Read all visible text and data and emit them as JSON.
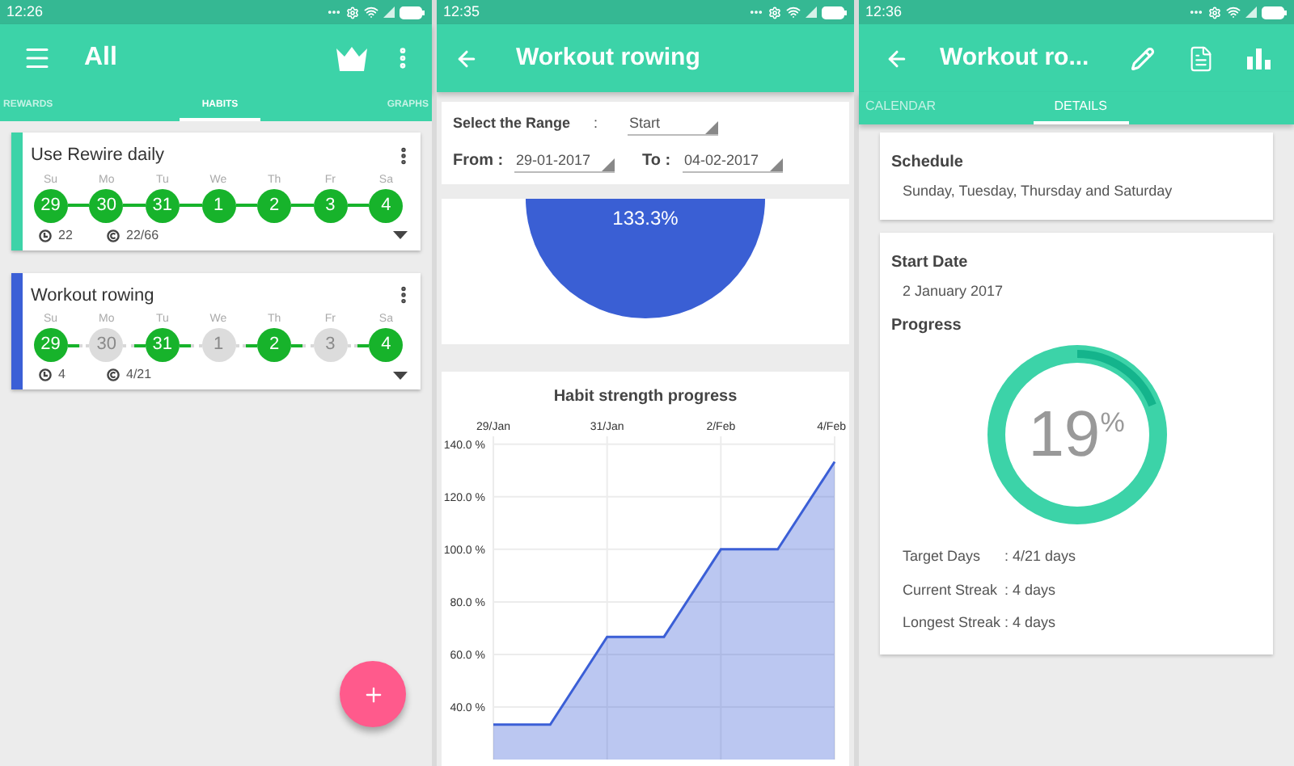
{
  "habits_screen": {
    "status_time": "12:26",
    "title": "All",
    "tabs": [
      {
        "label": "REWARDS",
        "selected": false
      },
      {
        "label": "HABITS",
        "selected": true
      },
      {
        "label": "GRAPHS",
        "selected": false
      }
    ],
    "habits": [
      {
        "name": "Use Rewire daily",
        "color": "#3dd3a8",
        "streak": "22",
        "score": "22/66",
        "days": [
          {
            "weekday": "Su",
            "date": "29",
            "done": true
          },
          {
            "weekday": "Mo",
            "date": "30",
            "done": true
          },
          {
            "weekday": "Tu",
            "date": "31",
            "done": true
          },
          {
            "weekday": "We",
            "date": "1",
            "done": true
          },
          {
            "weekday": "Th",
            "date": "2",
            "done": true
          },
          {
            "weekday": "Fr",
            "date": "3",
            "done": true
          },
          {
            "weekday": "Sa",
            "date": "4",
            "done": true
          }
        ]
      },
      {
        "name": "Workout rowing",
        "color": "#3b5fd6",
        "streak": "4",
        "score": "4/21",
        "days": [
          {
            "weekday": "Su",
            "date": "29",
            "done": true
          },
          {
            "weekday": "Mo",
            "date": "30",
            "done": false
          },
          {
            "weekday": "Tu",
            "date": "31",
            "done": true
          },
          {
            "weekday": "We",
            "date": "1",
            "done": false
          },
          {
            "weekday": "Th",
            "date": "2",
            "done": true
          },
          {
            "weekday": "Fr",
            "date": "3",
            "done": false
          },
          {
            "weekday": "Sa",
            "date": "4",
            "done": true
          }
        ]
      }
    ]
  },
  "range_screen": {
    "status_time": "12:35",
    "title": "Workout rowing",
    "range": {
      "label": "Select the Range",
      "separator": ":",
      "value": "Start"
    },
    "from": {
      "label": "From :",
      "value": "29-01-2017"
    },
    "to": {
      "label": "To :",
      "value": "04-02-2017"
    },
    "pie": {
      "label": "133.3%"
    },
    "chart_data": {
      "type": "area",
      "title": "Habit strength progress",
      "categories": [
        "29/Jan",
        null,
        "31/Jan",
        null,
        "2/Feb",
        null,
        "4/Feb"
      ],
      "ylim": [
        20,
        143
      ],
      "grid": true,
      "yticks": [
        {
          "value": 40,
          "label": "40.0 %"
        },
        {
          "value": 60,
          "label": "60.0 %"
        },
        {
          "value": 80,
          "label": "80.0 %"
        },
        {
          "value": 100,
          "label": "100.0 %"
        },
        {
          "value": 120,
          "label": "120.0 %"
        },
        {
          "value": 140,
          "label": "140.0 %"
        }
      ],
      "series": [
        {
          "color": "#3b5fd6",
          "values": [
            33.3,
            33.3,
            66.7,
            66.7,
            100,
            100,
            133.3
          ]
        }
      ]
    }
  },
  "details_screen": {
    "status_time": "12:36",
    "title": "Workout ro...",
    "tabs": [
      {
        "label": "CALENDAR",
        "selected": false
      },
      {
        "label": "DETAILS",
        "selected": true
      }
    ],
    "schedule": {
      "heading": "Schedule",
      "text": "Sunday, Tuesday, Thursday and Saturday"
    },
    "start_date": {
      "heading": "Start Date",
      "text": "2 January 2017"
    },
    "progress": {
      "heading": "Progress",
      "value": "19",
      "unit": "%",
      "level": 0.19
    },
    "stats": [
      {
        "label": "Target Days",
        "value": ": 4/21 days"
      },
      {
        "label": "Current Streak",
        "value": ": 4 days"
      },
      {
        "label": "Longest Streak",
        "value": ": 4 days"
      }
    ]
  }
}
